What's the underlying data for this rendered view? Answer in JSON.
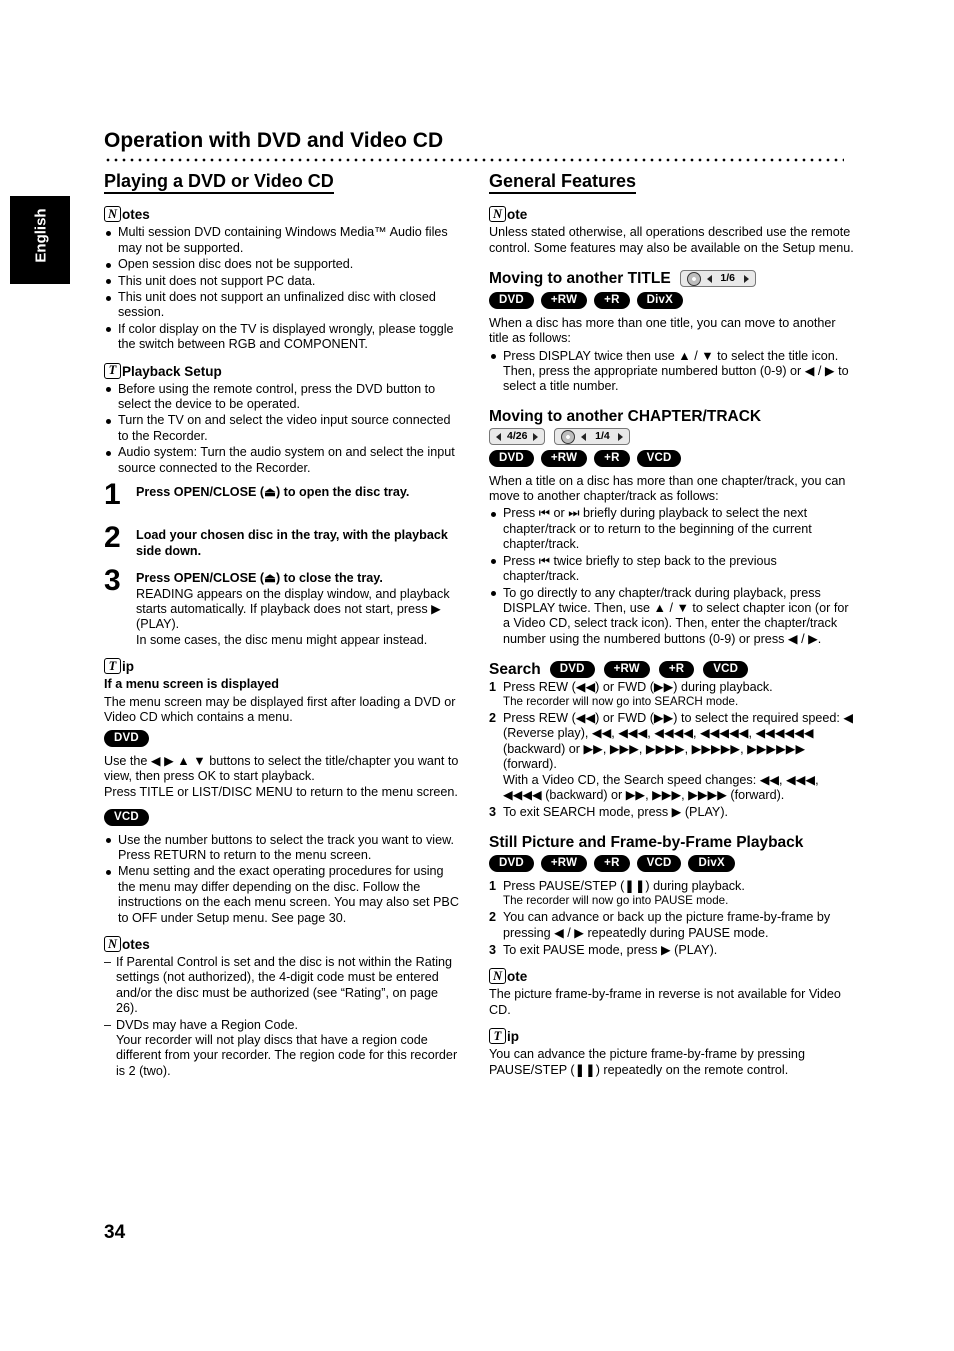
{
  "page": {
    "header_title": "Operation with DVD and Video CD",
    "side_tab": "English",
    "page_number": "34"
  },
  "labels": {
    "notes_glyph": "N",
    "notes_text": "otes",
    "note_glyph": "N",
    "note_text": "ote",
    "tip_glyph": "T",
    "tip_text": "ip"
  },
  "left": {
    "section_title": "Playing a DVD or Video CD",
    "notes1": [
      "Multi session DVD containing Windows Media™ Audio files may not be supported.",
      "Open session disc does not be supported.",
      "This unit does not support PC data.",
      "This unit does not support an unfinalized disc with closed session.",
      "If color display on the TV is displayed wrongly, please toggle the switch between RGB and COMPONENT."
    ],
    "playback_setup_title": "Playback Setup",
    "playback_setup_items": [
      "Before using the remote control, press the DVD button to select the device to be operated.",
      "Turn the TV on and select the video input source connected to the Recorder.",
      "Audio system: Turn the audio system on and select the input source connected to the Recorder."
    ],
    "steps": [
      {
        "num": "1",
        "bold": "Press OPEN/CLOSE (⏏) to open the disc tray.",
        "normal": ""
      },
      {
        "num": "2",
        "bold": "Load your chosen disc in the tray, with the playback side down.",
        "normal": ""
      },
      {
        "num": "3",
        "bold": "Press OPEN/CLOSE (⏏) to close the tray.",
        "normal": "READING appears on the display window, and playback starts automatically. If playback does not start, press ▶ (PLAY).\nIn some cases, the disc menu might appear instead."
      }
    ],
    "menu_heading": "If a menu screen is displayed",
    "menu_intro": "The menu screen may be displayed first after loading a DVD or Video CD which contains a menu.",
    "dvd_badge": "DVD",
    "dvd_text": "Use the ◀ ▶ ▲ ▼ buttons to select the title/chapter you want to view, then press OK to start playback.\nPress TITLE or LIST/DISC MENU to return to the menu screen.",
    "vcd_badge": "VCD",
    "vcd_items": [
      "Use the number buttons to select the track you want to view.\nPress RETURN to return to the menu screen.",
      "Menu setting and the exact operating procedures for using the menu may differ depending on the disc. Follow the instructions on the each menu screen. You may also set PBC to OFF under Setup menu. See page 30."
    ],
    "notes2": [
      "If Parental Control is set and the disc is not within the Rating settings (not authorized), the 4-digit code must be entered and/or the disc must be authorized (see “Rating”, on page 26).",
      "DVDs may have a Region Code.\nYour recorder will not play discs that have a region code different from your recorder. The region code for this recorder is 2 (two)."
    ]
  },
  "right": {
    "section_title": "General Features",
    "note_intro": "Unless stated otherwise, all operations described use the remote control. Some features may also be available on the Setup menu.",
    "title_section": {
      "heading": "Moving to another TITLE",
      "osd_value": "1/6",
      "badges": [
        "DVD",
        "+RW",
        "+R",
        "DivX"
      ],
      "intro": "When a disc has more than one title, you can move to another title as follows:",
      "bullets": [
        "Press DISPLAY twice then use ▲ / ▼ to select the title icon. Then, press the appropriate numbered button (0-9) or ◀ / ▶ to select a title number."
      ]
    },
    "chapter_section": {
      "heading": "Moving to another CHAPTER/TRACK",
      "osd_value_1": "4/26",
      "osd_value_2": "1/4",
      "badges": [
        "DVD",
        "+RW",
        "+R",
        "VCD"
      ],
      "intro": "When a title on a disc has more than one chapter/track, you can move to another chapter/track as follows:",
      "bullets": [
        "Press ⏮ or ⏭ briefly during playback to select the next chapter/track or to return to the beginning of the current chapter/track.",
        "Press ⏮ twice briefly to step back to the previous chapter/track.",
        "To go directly to any chapter/track during playback, press DISPLAY twice. Then, use ▲ / ▼ to select chapter icon (or for a Video CD, select track icon). Then, enter the chapter/track number using the numbered buttons (0-9) or press ◀ / ▶."
      ]
    },
    "search_section": {
      "heading": "Search",
      "badges": [
        "DVD",
        "+RW",
        "+R",
        "VCD"
      ],
      "steps": [
        {
          "n": "1",
          "text": "Press REW (◀◀) or FWD (▶▶) during playback.",
          "sub": "The recorder will now go into SEARCH mode."
        },
        {
          "n": "2",
          "text": "Press REW (◀◀) or FWD (▶▶) to select the required speed: ◀ (Reverse play), ◀◀, ◀◀◀, ◀◀◀◀, ◀◀◀◀◀, ◀◀◀◀◀◀ (backward) or ▶▶, ▶▶▶, ▶▶▶▶, ▶▶▶▶▶, ▶▶▶▶▶▶ (forward).\nWith a Video CD, the Search speed changes: ◀◀, ◀◀◀, ◀◀◀◀ (backward) or ▶▶, ▶▶▶, ▶▶▶▶ (forward).",
          "sub": ""
        },
        {
          "n": "3",
          "text": "To exit SEARCH mode, press ▶ (PLAY).",
          "sub": ""
        }
      ]
    },
    "still_section": {
      "heading": "Still Picture and Frame-by-Frame Playback",
      "badges": [
        "DVD",
        "+RW",
        "+R",
        "VCD",
        "DivX"
      ],
      "steps": [
        {
          "n": "1",
          "text": "Press PAUSE/STEP (❚❚) during playback.",
          "sub": "The recorder will now go into PAUSE mode."
        },
        {
          "n": "2",
          "text": "You can advance or back up the picture frame-by-frame by pressing ◀ / ▶ repeatedly during PAUSE mode.",
          "sub": ""
        },
        {
          "n": "3",
          "text": "To exit PAUSE mode, press ▶ (PLAY).",
          "sub": ""
        }
      ],
      "note_text": "The picture frame-by-frame in reverse is not available for Video CD.",
      "tip_text": "You can advance the picture frame-by-frame by pressing PAUSE/STEP (❚❚) repeatedly on the remote control."
    }
  }
}
